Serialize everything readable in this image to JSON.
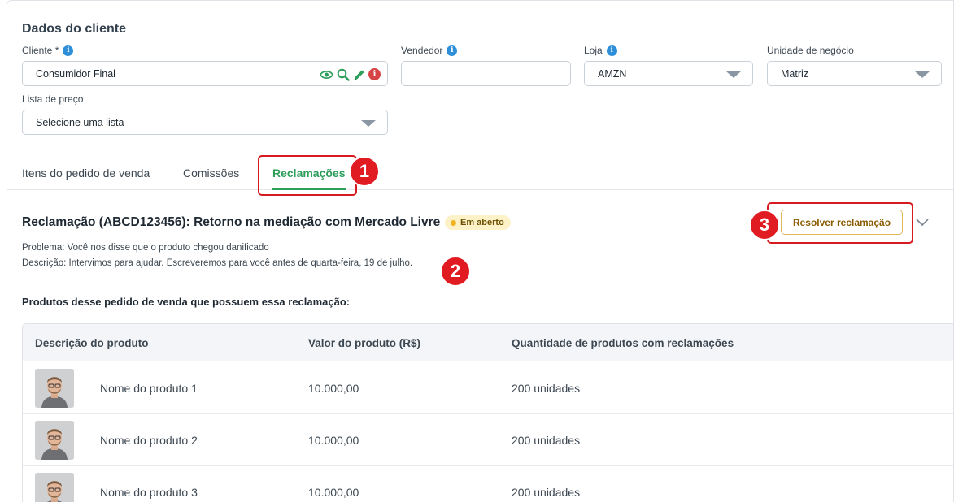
{
  "section": {
    "title": "Dados do cliente"
  },
  "fields": {
    "cliente": {
      "label": "Cliente *",
      "value": "Consumidor Final"
    },
    "vendedor": {
      "label": "Vendedor",
      "value": ""
    },
    "loja": {
      "label": "Loja",
      "value": "AMZN"
    },
    "unidade": {
      "label": "Unidade de negócio",
      "value": "Matriz"
    },
    "lista": {
      "label": "Lista de preço",
      "value": "Selecione uma lista"
    }
  },
  "tabs": [
    {
      "label": "Itens do pedido de venda"
    },
    {
      "label": "Comissões"
    },
    {
      "label": "Reclamações"
    }
  ],
  "markers": {
    "one": "1",
    "two": "2",
    "three": "3"
  },
  "claim": {
    "title": "Reclamação (ABCD123456): Retorno na mediação com Mercado Livre",
    "status": "Em aberto",
    "problem": "Problema: Você nos disse que o produto chegou danificado",
    "description": "Descrição: Intervimos para ajudar. Escreveremos para você antes de quarta-feira, 19 de julho.",
    "resolve_label": "Resolver reclamação"
  },
  "products": {
    "title": "Produtos desse pedido de venda que possuem essa reclamação:",
    "headers": [
      "Descrição do produto",
      "Valor do produto (R$)",
      "Quantidade de produtos com reclamações"
    ],
    "rows": [
      {
        "name": "Nome do produto 1",
        "value": "10.000,00",
        "qty": "200 unidades"
      },
      {
        "name": "Nome do produto 2",
        "value": "10.000,00",
        "qty": "200 unidades"
      },
      {
        "name": "Nome do produto 3",
        "value": "10.000,00",
        "qty": "200 unidades"
      }
    ]
  },
  "colors": {
    "accent_green": "#2e9e5b",
    "marker_red": "#e11b22",
    "status_bg": "#fdf1c8",
    "info_blue": "#2e8fd8"
  },
  "icons": [
    "info-icon",
    "eye-icon",
    "search-icon",
    "pencil-icon",
    "alert-info-icon",
    "caret-down-icon",
    "chevron-down-icon",
    "product-photo"
  ]
}
